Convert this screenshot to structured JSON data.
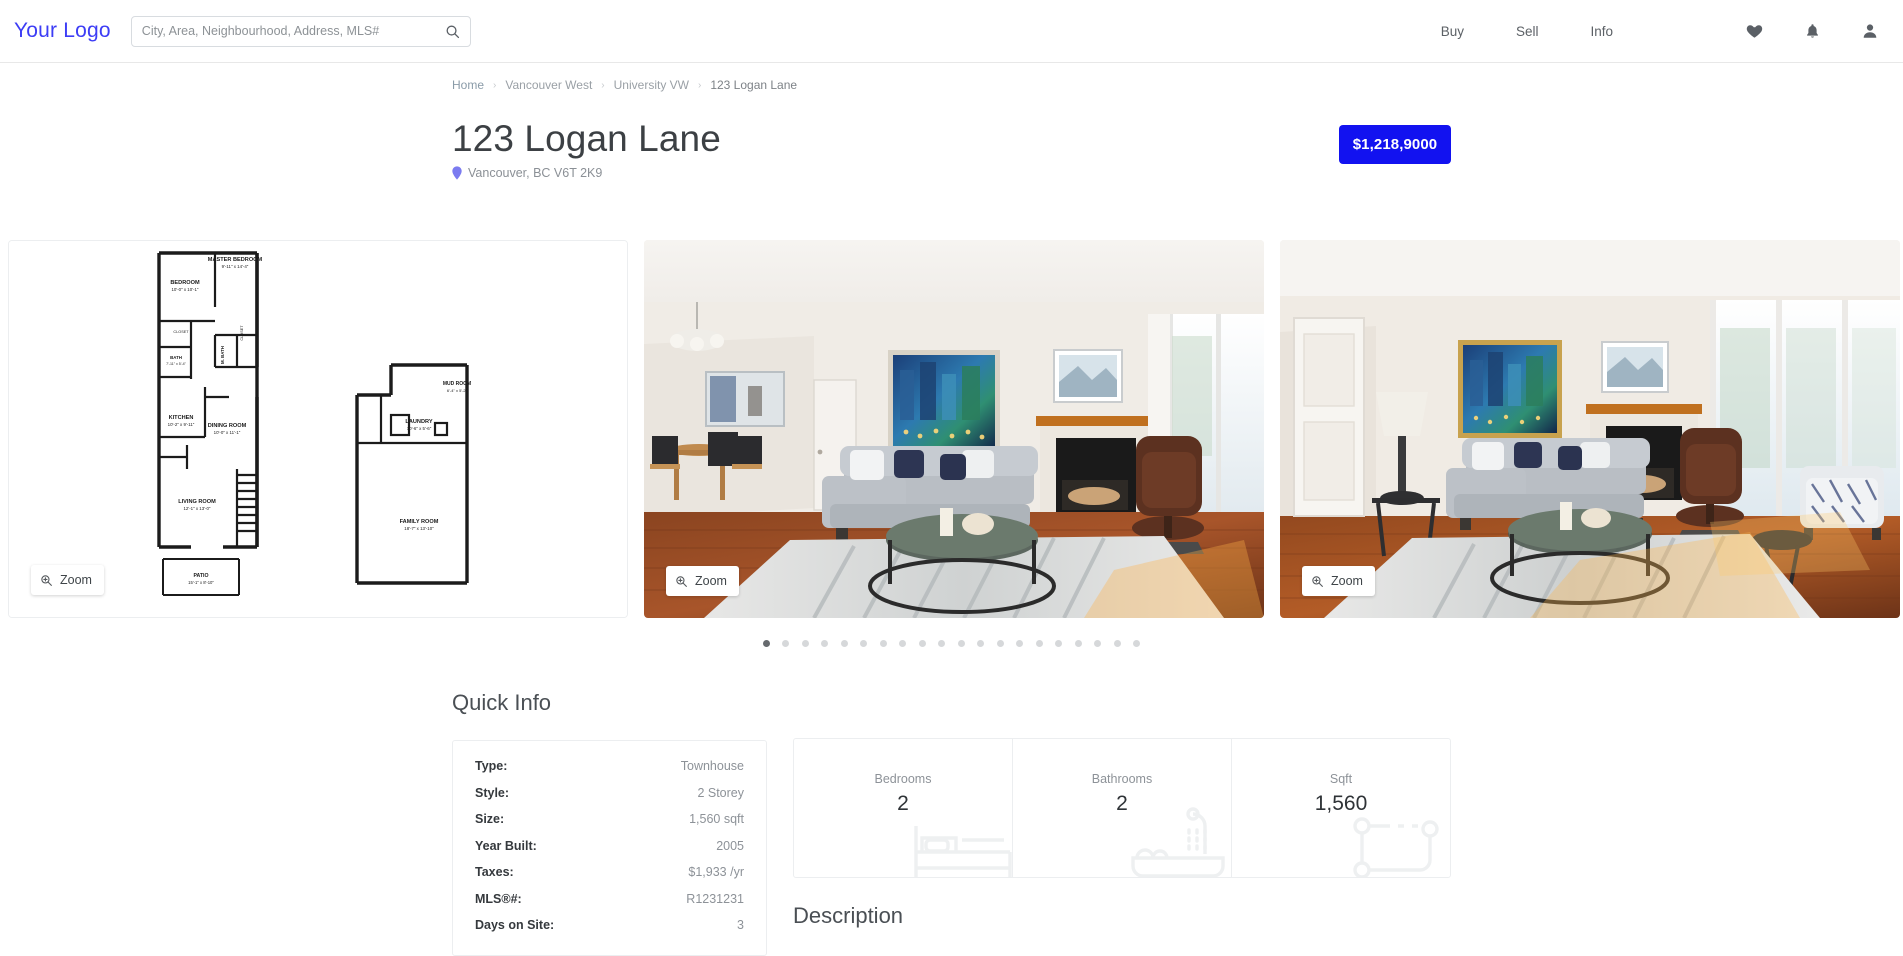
{
  "header": {
    "logo": "Your Logo",
    "search": {
      "placeholder": "City, Area, Neighbourhood, Address, MLS#",
      "value": "",
      "icon": "search-icon"
    },
    "nav": [
      {
        "label": "Buy"
      },
      {
        "label": "Sell"
      },
      {
        "label": "Info"
      }
    ],
    "icons": [
      {
        "name": "heart-icon"
      },
      {
        "name": "bell-icon"
      },
      {
        "name": "account-icon"
      }
    ]
  },
  "breadcrumb": {
    "separator": "›",
    "items": [
      {
        "label": "Home"
      },
      {
        "label": "Vancouver West"
      },
      {
        "label": "University VW"
      },
      {
        "label": "123 Logan Lane"
      }
    ]
  },
  "listing": {
    "title": "123 Logan Lane",
    "address": "Vancouver, BC V6T 2K9",
    "pin_icon": "map-pin-icon",
    "pin_color": "#7b7bf0",
    "price": "$1,218,9000",
    "price_bg": "#1212f0"
  },
  "gallery": {
    "zoom_label": "Zoom",
    "zoom_icon": "magnifier-plus-icon",
    "slides": [
      {
        "name": "floorplan",
        "alt": "Floor plan drawing"
      },
      {
        "name": "living-room-photo",
        "alt": "Living room with fireplace"
      },
      {
        "name": "living-room-photo-wide",
        "alt": "Living room wide angle"
      }
    ],
    "dot_count": 20,
    "active_dot": 0
  },
  "floorplan": {
    "rooms": [
      "MASTER BEDROOM",
      "BEDROOM",
      "BATH",
      "M. BATH",
      "CLOSET",
      "KITCHEN",
      "DINING ROOM",
      "LIVING ROOM",
      "PATIO",
      "LAUNDRY",
      "FAMILY ROOM",
      "MUD ROOM"
    ]
  },
  "quick_info": {
    "heading": "Quick Info",
    "rows": [
      {
        "key": "Type:",
        "value": "Townhouse"
      },
      {
        "key": "Style:",
        "value": "2 Storey"
      },
      {
        "key": "Size:",
        "value": "1,560 sqft"
      },
      {
        "key": "Year Built:",
        "value": "2005"
      },
      {
        "key": "Taxes:",
        "value": "$1,933 /yr"
      },
      {
        "key": "MLS®#:",
        "value": "R1231231"
      },
      {
        "key": "Days on Site:",
        "value": "3"
      }
    ]
  },
  "stats": [
    {
      "label": "Bedrooms",
      "value": "2",
      "icon": "bed-icon"
    },
    {
      "label": "Bathrooms",
      "value": "2",
      "icon": "bathtub-icon"
    },
    {
      "label": "Sqft",
      "value": "1,560",
      "icon": "floorplan-icon"
    }
  ],
  "description": {
    "heading": "Description"
  }
}
